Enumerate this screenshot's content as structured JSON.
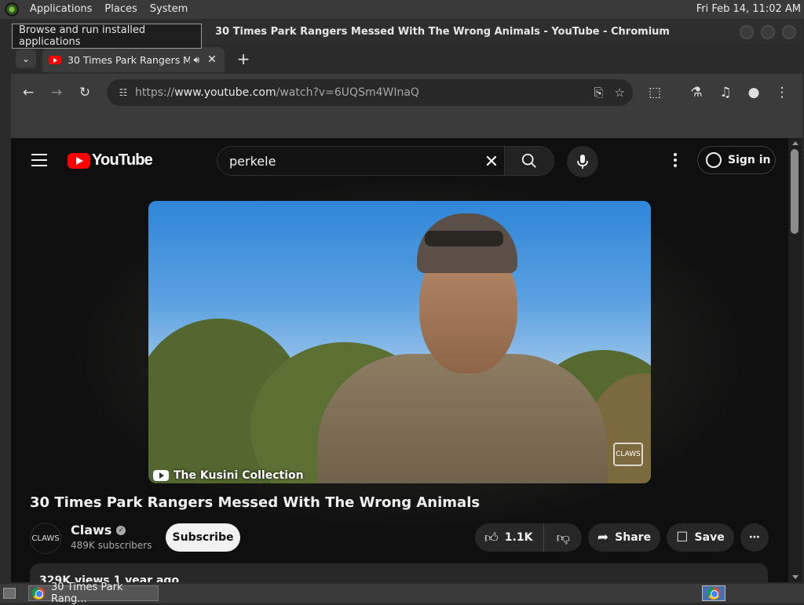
{
  "top_panel": {
    "menus": [
      "Applications",
      "Places",
      "System"
    ],
    "clock": "Fri Feb 14, 11:02 AM"
  },
  "tooltip": "Browse and run installed applications",
  "window": {
    "title": "30 Times Park Rangers Messed With The Wrong Animals - YouTube - Chromium"
  },
  "tab": {
    "label": "30 Times Park Rangers M",
    "close": "✕"
  },
  "toolbar": {
    "url_scheme": "https://",
    "url_host": "www.youtube.com",
    "url_path": "/watch?v=6UQSm4WInaQ"
  },
  "youtube": {
    "logo_text": "YouTube",
    "search_value": "perkele",
    "sign_in": "Sign in",
    "video": {
      "watermark": "The Kusini Collection",
      "corner_mark": "CLAWS",
      "title": "30 Times Park Rangers Messed With The Wrong Animals"
    },
    "channel": {
      "avatar_text": "CLAWS",
      "name": "Claws",
      "subscribers": "489K subscribers"
    },
    "subscribe": "Subscribe",
    "likes": "1.1K",
    "share": "Share",
    "save": "Save",
    "description_meta": "329K views  1 year ago"
  },
  "taskbar": {
    "task_label": "30 Times Park Rang..."
  },
  "colors": {
    "yt_red": "#ff0000",
    "page_bg": "#0f0f0f",
    "chrome_toolbar": "#3b3b3b"
  }
}
